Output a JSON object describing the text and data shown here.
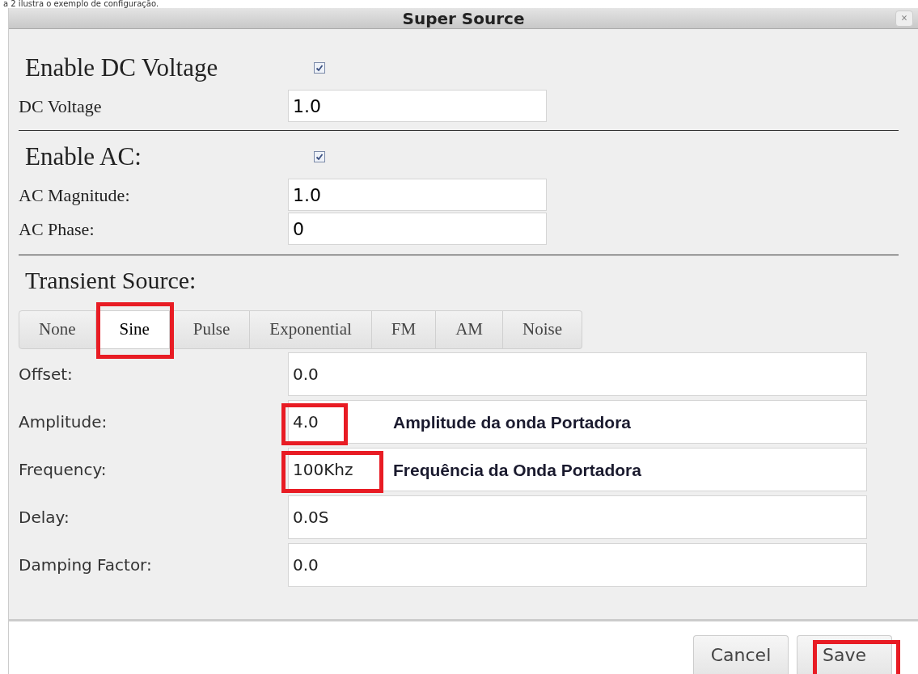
{
  "caption": "a 2 ilustra o exemplo de configuração.",
  "window": {
    "title": "Super Source",
    "close": "×"
  },
  "dc": {
    "enable_label": "Enable DC Voltage",
    "enabled": true,
    "voltage_label": "DC Voltage",
    "voltage": "1.0"
  },
  "ac": {
    "enable_label": "Enable AC:",
    "enabled": true,
    "magnitude_label": "AC Magnitude:",
    "magnitude": "1.0",
    "phase_label": "AC Phase:",
    "phase": "0"
  },
  "transient": {
    "label": "Transient Source:",
    "tabs": [
      {
        "label": "None",
        "selected": false,
        "highlighted": false
      },
      {
        "label": "Sine",
        "selected": true,
        "highlighted": true
      },
      {
        "label": "Pulse",
        "selected": false,
        "highlighted": false
      },
      {
        "label": "Exponential",
        "selected": false,
        "highlighted": false
      },
      {
        "label": "FM",
        "selected": false,
        "highlighted": false
      },
      {
        "label": "AM",
        "selected": false,
        "highlighted": false
      },
      {
        "label": "Noise",
        "selected": false,
        "highlighted": false
      }
    ],
    "fields": [
      {
        "label": "Offset:",
        "value": "0.0",
        "highlighted": false
      },
      {
        "label": "Amplitude:",
        "value": "4.0",
        "highlighted": true,
        "annotation": "Amplitude da onda Portadora"
      },
      {
        "label": "Frequency:",
        "value": "100Khz",
        "highlighted": true,
        "annotation": "Frequência da Onda Portadora"
      },
      {
        "label": "Delay:",
        "value": "0.0S",
        "highlighted": false
      },
      {
        "label": "Damping Factor:",
        "value": "0.0",
        "highlighted": false
      }
    ]
  },
  "buttons": [
    {
      "label": "Cancel",
      "highlighted": false
    },
    {
      "label": "Save",
      "highlighted": true
    }
  ]
}
